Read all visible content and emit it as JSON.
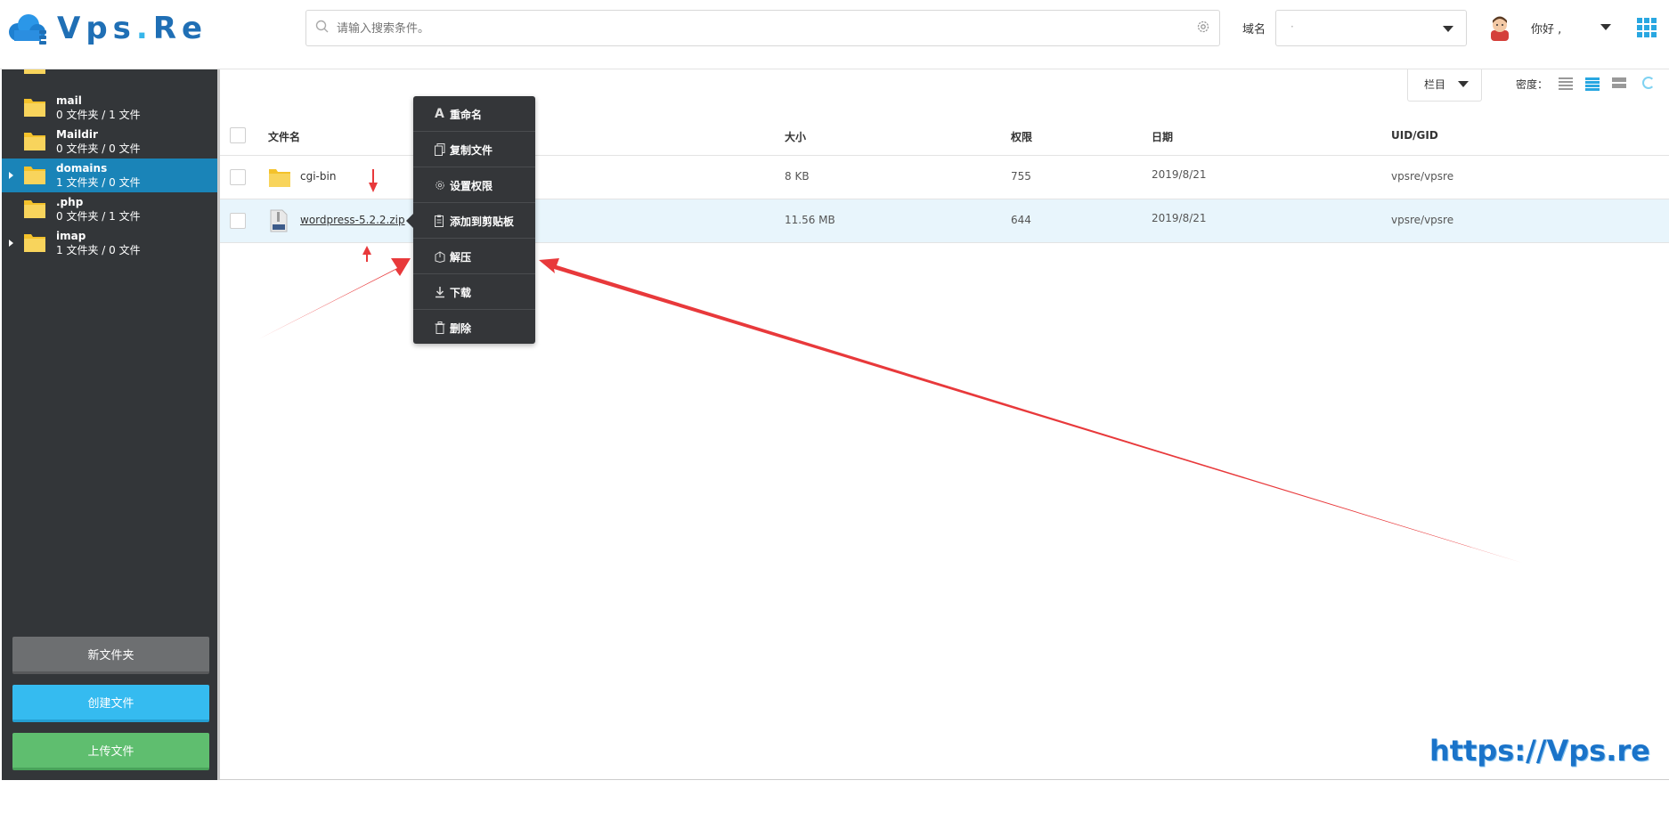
{
  "header": {
    "logo_text": "Vps",
    "logo_dot": ".",
    "logo_suffix": "Re",
    "search_placeholder": "请输入搜索条件。",
    "domain_label": "域名",
    "domain_value": "·",
    "greeting": "你好 ,",
    "icons": [
      "search-icon",
      "gear-icon",
      "chevron-down-icon",
      "avatar",
      "apps-grid-icon"
    ]
  },
  "sidebar": {
    "items": [
      {
        "name": "mail",
        "meta": "0 文件夹 / 1 文件",
        "expandable": false,
        "active": false
      },
      {
        "name": "Maildir",
        "meta": "0 文件夹 / 0 文件",
        "expandable": false,
        "active": false
      },
      {
        "name": "domains",
        "meta": "1 文件夹 / 0 文件",
        "expandable": true,
        "active": true
      },
      {
        "name": ".php",
        "meta": "0 文件夹 / 1 文件",
        "expandable": false,
        "active": false
      },
      {
        "name": "imap",
        "meta": "1 文件夹 / 0 文件",
        "expandable": true,
        "active": false
      }
    ],
    "buttons": {
      "new_folder": "新文件夹",
      "create_file": "创建文件",
      "upload_file": "上传文件"
    }
  },
  "toolbar": {
    "columns_label": "栏目",
    "density_label": "密度："
  },
  "table": {
    "headers": {
      "name": "文件名",
      "size": "大小",
      "perm": "权限",
      "date": "日期",
      "owner": "UID/GID"
    },
    "rows": [
      {
        "name": "cgi-bin",
        "size": "8 KB",
        "perm": "755",
        "date": "2019/8/21",
        "owner": "vpsre/vpsre",
        "type": "folder"
      },
      {
        "name": "wordpress-5.2.2.zip",
        "size": "11.56 MB",
        "perm": "644",
        "date": "2019/8/21",
        "owner": "vpsre/vpsre",
        "type": "zip"
      }
    ]
  },
  "context_menu": {
    "items": [
      {
        "label": "重命名",
        "icon": "rename-icon"
      },
      {
        "label": "复制文件",
        "icon": "copy-icon"
      },
      {
        "label": "设置权限",
        "icon": "gear-icon"
      },
      {
        "label": "添加到剪贴板",
        "icon": "clipboard-icon"
      },
      {
        "label": "解压",
        "icon": "extract-icon"
      },
      {
        "label": "下载",
        "icon": "download-icon"
      },
      {
        "label": "删除",
        "icon": "trash-icon"
      }
    ]
  },
  "watermark": "https://Vps.re",
  "colors": {
    "accent": "#29a7e1",
    "sidebar": "#333639",
    "active": "#1a84b8",
    "annotation": "#e8393b"
  }
}
